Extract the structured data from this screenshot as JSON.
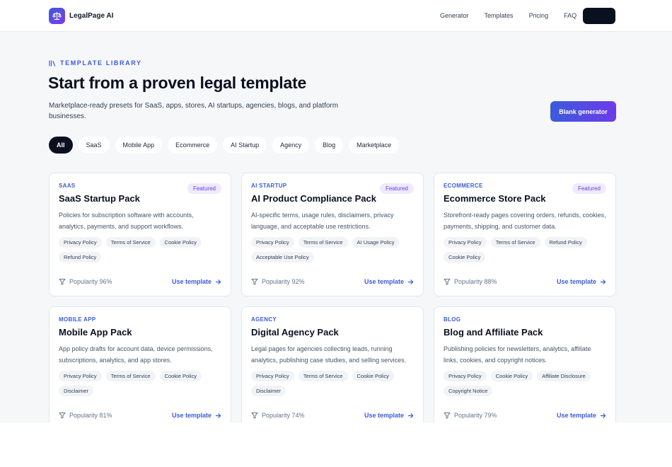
{
  "header": {
    "brand": "LegalPage AI",
    "nav": [
      "Generator",
      "Templates",
      "Pricing",
      "FAQ"
    ]
  },
  "hero": {
    "kicker": "TEMPLATE LIBRARY",
    "title": "Start from a proven legal template",
    "subtitle": "Marketplace-ready presets for SaaS, apps, stores, AI startups, agencies, blogs, and platform businesses.",
    "blank_button": "Blank generator"
  },
  "filters": [
    "All",
    "SaaS",
    "Mobile App",
    "Ecommerce",
    "AI Startup",
    "Agency",
    "Blog",
    "Marketplace"
  ],
  "cards": [
    {
      "category": "SAAS",
      "title": "SaaS Startup Pack",
      "badge": "Featured",
      "description": "Policies for subscription software with accounts, analytics, payments, and support workflows.",
      "tags": [
        "Privacy Policy",
        "Terms of Service",
        "Cookie Policy",
        "Refund Policy"
      ],
      "popularity": "Popularity 96%",
      "cta": "Use template"
    },
    {
      "category": "AI STARTUP",
      "title": "AI Product Compliance Pack",
      "badge": "Featured",
      "description": "AI-specific terms, usage rules, disclaimers, privacy language, and acceptable use restrictions.",
      "tags": [
        "Privacy Policy",
        "Terms of Service",
        "AI Usage Policy",
        "Acceptable Use Policy"
      ],
      "popularity": "Popularity 92%",
      "cta": "Use template"
    },
    {
      "category": "ECOMMERCE",
      "title": "Ecommerce Store Pack",
      "badge": "Featured",
      "description": "Storefront-ready pages covering orders, refunds, cookies, payments, shipping, and customer data.",
      "tags": [
        "Privacy Policy",
        "Terms of Service",
        "Refund Policy",
        "Cookie Policy"
      ],
      "popularity": "Popularity 88%",
      "cta": "Use template"
    },
    {
      "category": "MOBILE APP",
      "title": "Mobile App Pack",
      "badge": "",
      "description": "App policy drafts for account data, device permissions, subscriptions, analytics, and app stores.",
      "tags": [
        "Privacy Policy",
        "Terms of Service",
        "Cookie Policy",
        "Disclaimer"
      ],
      "popularity": "Popularity 81%",
      "cta": "Use template"
    },
    {
      "category": "AGENCY",
      "title": "Digital Agency Pack",
      "badge": "",
      "description": "Legal pages for agencies collecting leads, running analytics, publishing case studies, and selling services.",
      "tags": [
        "Privacy Policy",
        "Terms of Service",
        "Cookie Policy",
        "Disclaimer"
      ],
      "popularity": "Popularity 74%",
      "cta": "Use template"
    },
    {
      "category": "BLOG",
      "title": "Blog and Affiliate Pack",
      "badge": "",
      "description": "Publishing policies for newsletters, analytics, affiliate links, cookies, and copyright notices.",
      "tags": [
        "Privacy Policy",
        "Cookie Policy",
        "Affiliate Disclosure",
        "Copyright Notice"
      ],
      "popularity": "Popularity 79%",
      "cta": "Use template"
    }
  ],
  "colors": {
    "accent": "#3b5bdb",
    "purple": "#6d3bea",
    "dark": "#0b1020"
  }
}
